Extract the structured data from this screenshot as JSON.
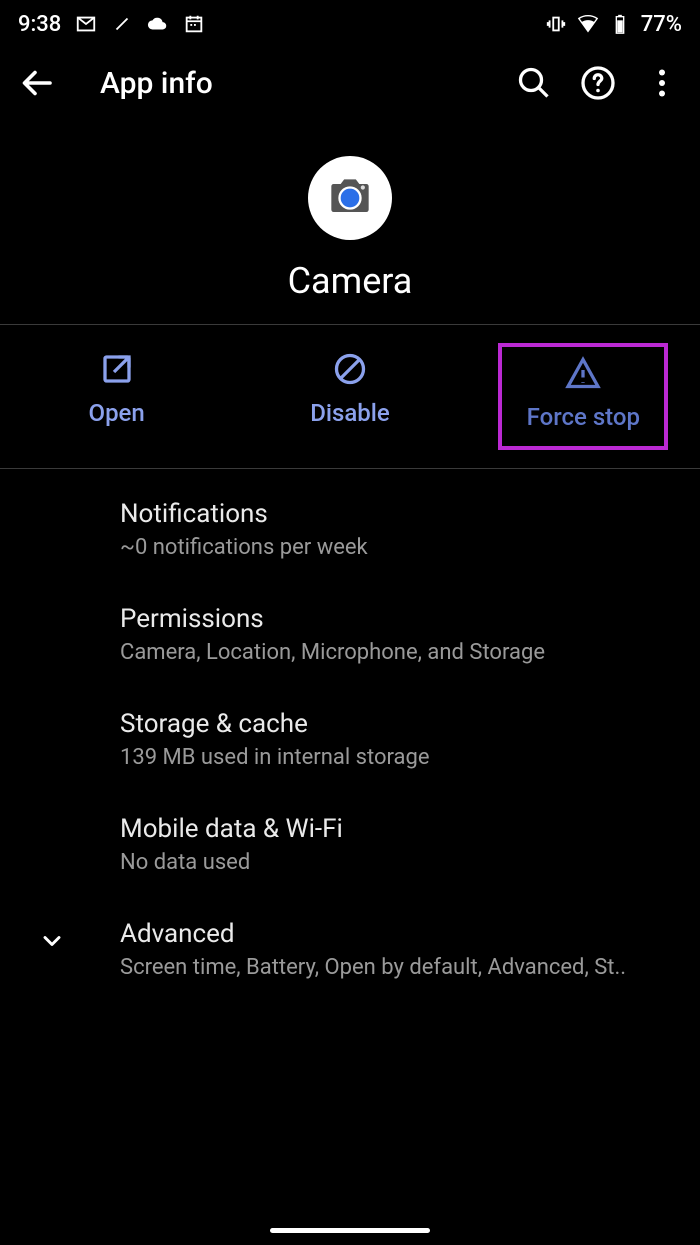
{
  "status": {
    "time": "9:38",
    "battery": "77%"
  },
  "toolbar": {
    "title": "App info"
  },
  "app": {
    "name": "Camera"
  },
  "actions": {
    "open": "Open",
    "disable": "Disable",
    "force_stop": "Force stop"
  },
  "items": [
    {
      "title": "Notifications",
      "sub": "~0 notifications per week"
    },
    {
      "title": "Permissions",
      "sub": "Camera, Location, Microphone, and Storage"
    },
    {
      "title": "Storage & cache",
      "sub": "139 MB used in internal storage"
    },
    {
      "title": "Mobile data & Wi-Fi",
      "sub": "No data used"
    },
    {
      "title": "Advanced",
      "sub": "Screen time, Battery, Open by default, Advanced, St.."
    }
  ]
}
